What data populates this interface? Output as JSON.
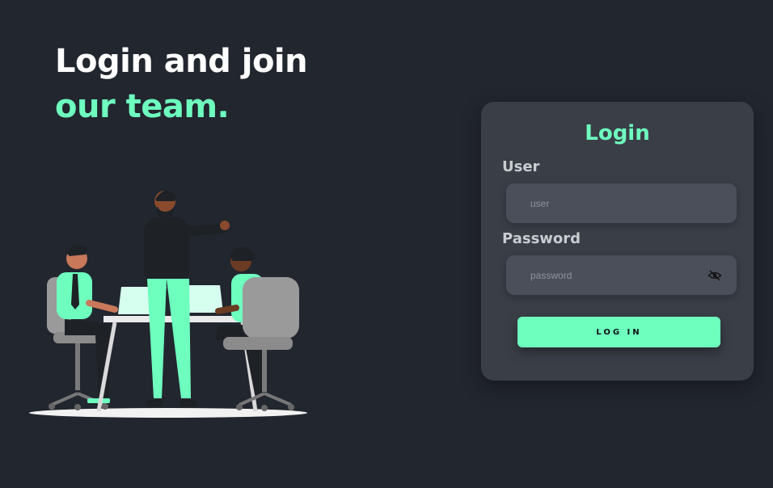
{
  "hero": {
    "line1": "Login and join",
    "line2": "our team."
  },
  "login_card": {
    "title": "Login",
    "user_label": "User",
    "user_placeholder": "user",
    "password_label": "Password",
    "password_placeholder": "password",
    "login_button": "LOG IN"
  },
  "colors": {
    "background": "#22262f",
    "card": "#3a3e47",
    "input": "#4a4f59",
    "accent": "#6effbf"
  },
  "icons": {
    "password_toggle": "eye-slash-icon"
  }
}
